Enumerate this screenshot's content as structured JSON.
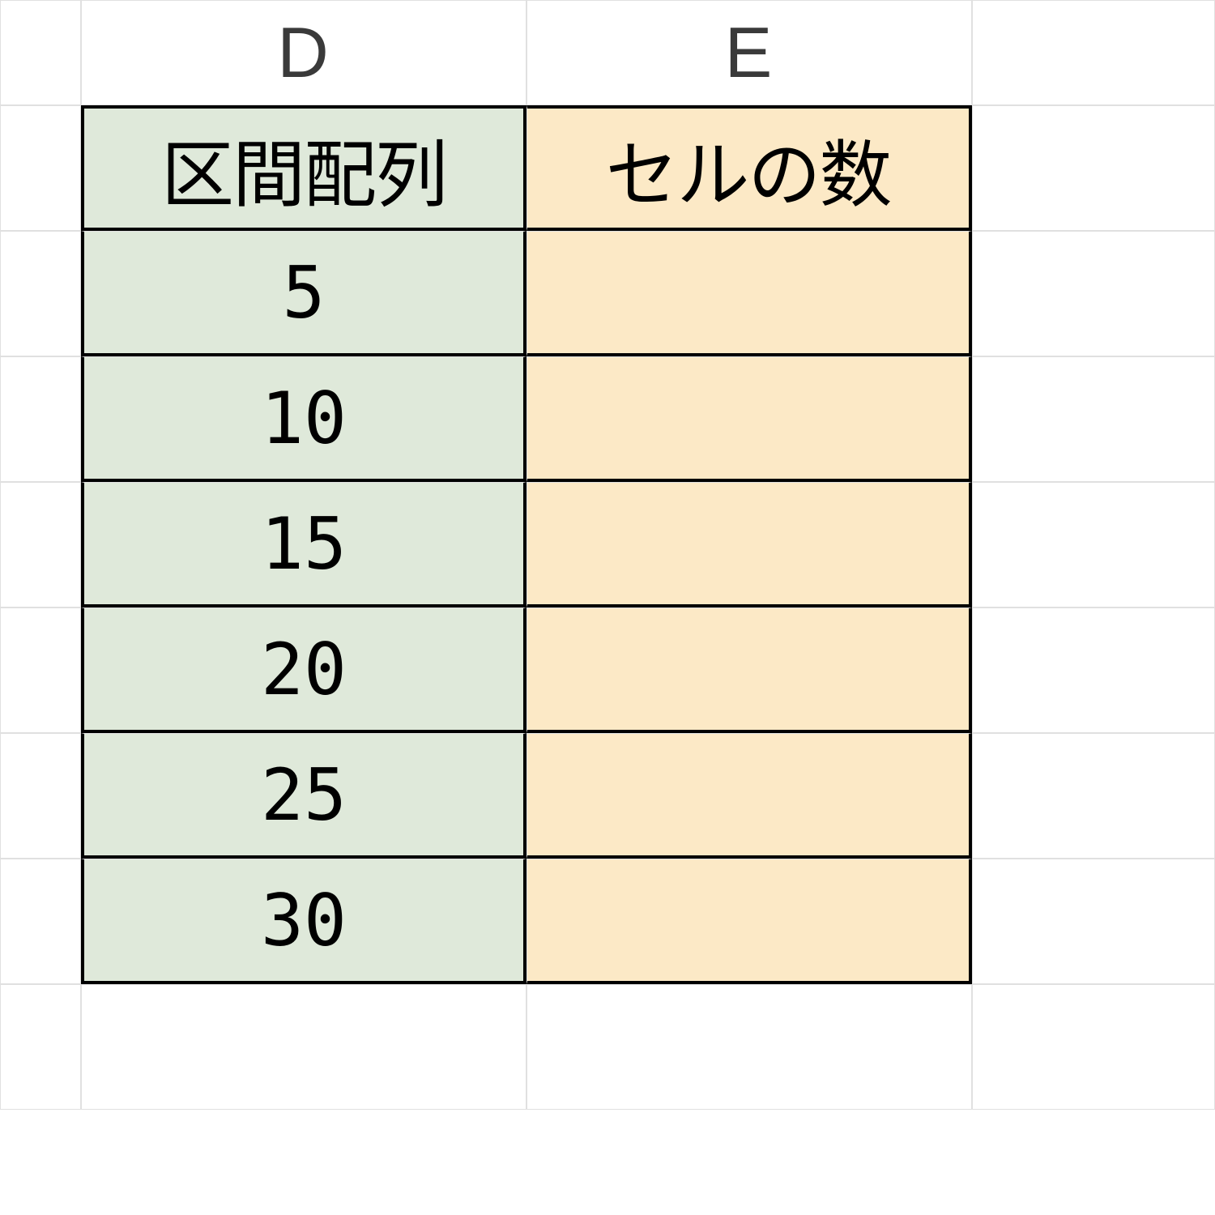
{
  "columns": {
    "c": "",
    "d": "D",
    "e": "E",
    "f": ""
  },
  "table": {
    "headers": {
      "d": "区間配列",
      "e": "セルの数"
    },
    "rows": [
      {
        "d": "5",
        "e": ""
      },
      {
        "d": "10",
        "e": ""
      },
      {
        "d": "15",
        "e": ""
      },
      {
        "d": "20",
        "e": ""
      },
      {
        "d": "25",
        "e": ""
      },
      {
        "d": "30",
        "e": ""
      }
    ]
  }
}
